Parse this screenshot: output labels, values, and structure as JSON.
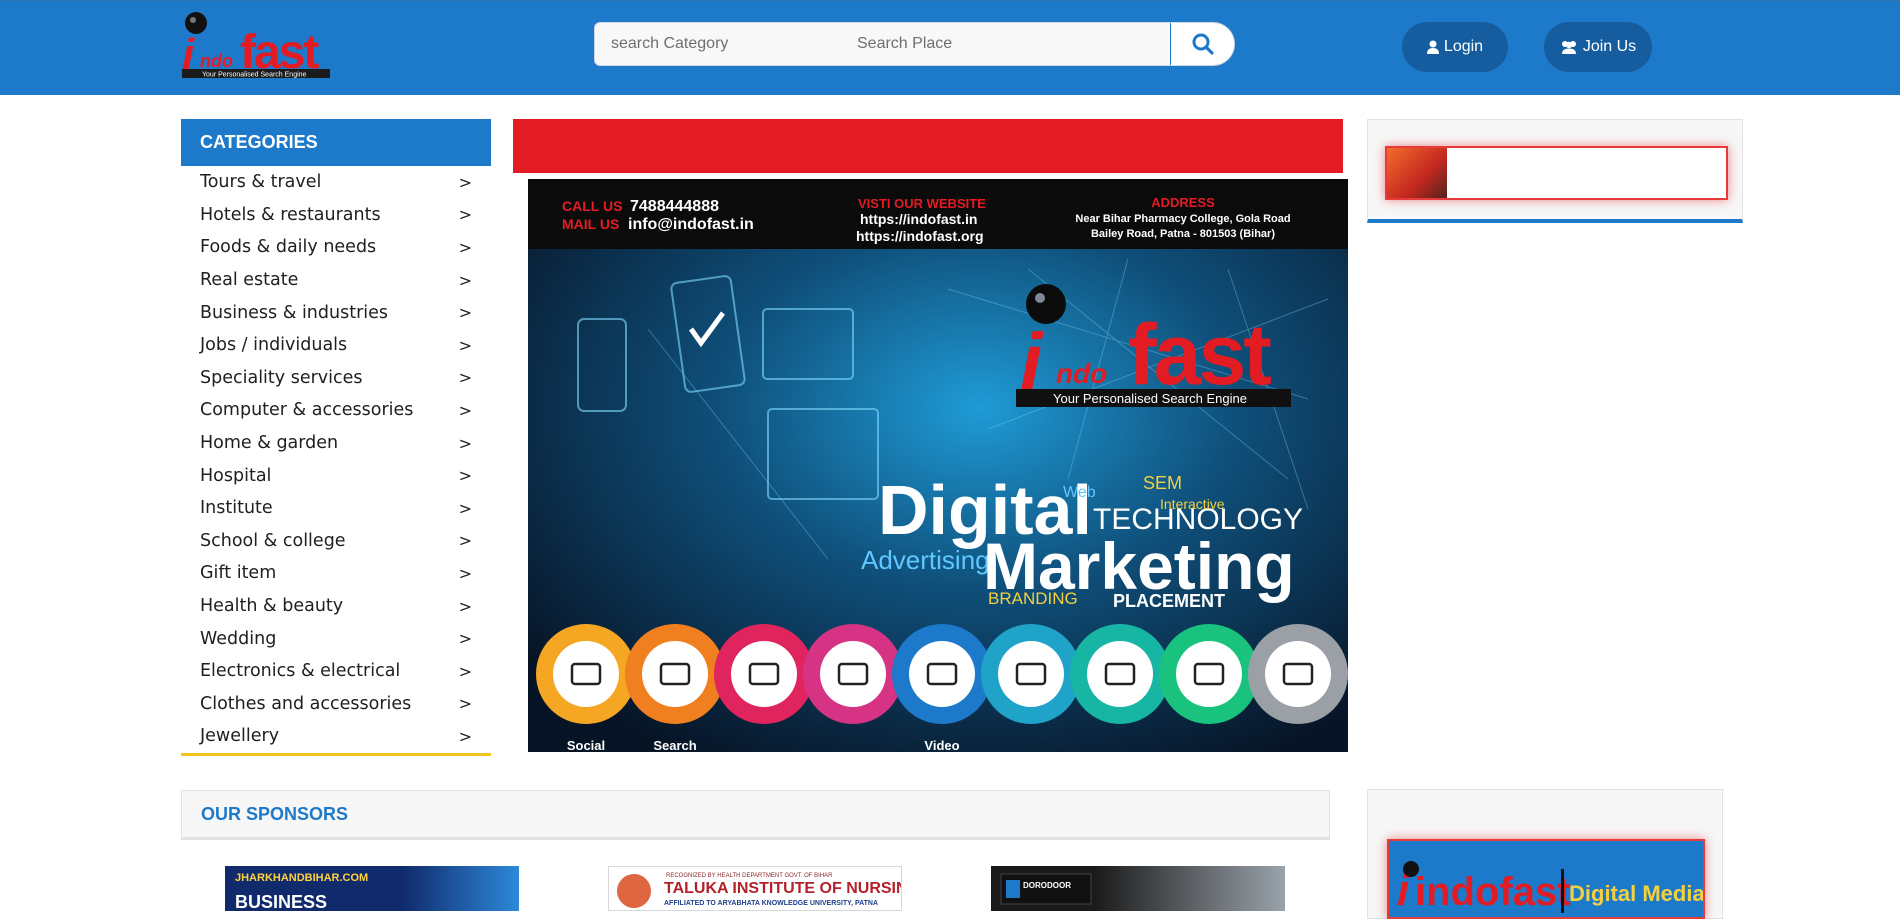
{
  "header": {
    "logo": {
      "text": "indofast",
      "tagline": "Your Personalised Search Engine"
    },
    "search": {
      "category_placeholder": "search Category",
      "place_placeholder": "Search Place"
    },
    "login_label": "Login",
    "join_label": "Join Us"
  },
  "categories": {
    "title": "CATEGORIES",
    "items": [
      {
        "label": "Tours & travel",
        "arrow": ">"
      },
      {
        "label": "Hotels & restaurants",
        "arrow": ">"
      },
      {
        "label": "Foods & daily needs",
        "arrow": ">"
      },
      {
        "label": "Real estate",
        "arrow": ">"
      },
      {
        "label": "Business & industries",
        "arrow": ">"
      },
      {
        "label": "Jobs / individuals",
        "arrow": ">"
      },
      {
        "label": "Speciality services",
        "arrow": ">"
      },
      {
        "label": "Computer & accessories",
        "arrow": ">"
      },
      {
        "label": "Home & garden",
        "arrow": ">"
      },
      {
        "label": "Hospital",
        "arrow": ">"
      },
      {
        "label": "Institute",
        "arrow": ">"
      },
      {
        "label": "School & college",
        "arrow": ">"
      },
      {
        "label": "Gift item",
        "arrow": ">"
      },
      {
        "label": "Health & beauty",
        "arrow": ">"
      },
      {
        "label": "Wedding",
        "arrow": ">"
      },
      {
        "label": "Electronics & electrical",
        "arrow": ">"
      },
      {
        "label": "Clothes and accessories",
        "arrow": ">"
      },
      {
        "label": "Jewellery",
        "arrow": ">"
      }
    ]
  },
  "banner": {
    "call_label": "CALL US",
    "phone": "7488444888",
    "mail_label": "MAIL US",
    "email": "info@indofast.in",
    "website_label": "VISTI OUR WEBSITE",
    "website1": "https://indofast.in",
    "website2": "https://indofast.org",
    "address_label": "ADDRESS",
    "address_line1": "Near Bihar Pharmacy College, Gola Road",
    "address_line2": "Bailey Road, Patna - 801503 (Bihar)",
    "logo_text": "indofast",
    "logo_tagline": "Your Personalised Search Engine",
    "headline1": "Digital",
    "headline2": "Marketing",
    "tech_word": "TECHNOLOGY",
    "adv_word": "Advertising",
    "branding_word": "BRANDING",
    "placement_word": "PLACEMENT",
    "circle_labels": [
      "Social",
      "Search",
      "",
      "",
      "Video",
      "",
      "",
      "",
      ""
    ],
    "circle_colors": [
      "#f5a623",
      "#f07f1f",
      "#e0245e",
      "#d63384",
      "#1d79c9",
      "#1fa3c9",
      "#17b6a4",
      "#19c27d",
      "#9aa0a6"
    ]
  },
  "sponsors": {
    "title": "OUR SPONSORS",
    "items": [
      {
        "line1": "JHARKHANDBIHAR.COM",
        "line2": "BUSINESS"
      },
      {
        "line1": "RECOGNIZED BY HEALTH DEPARTMENT GOVT. OF BIHAR",
        "line2": "TALUKA INSTITUTE OF NURSING",
        "line3": "AFFILIATED TO ARYABHATA KNOWLEDGE UNIVERSITY, PATNA"
      },
      {
        "line1": "DORODOOR"
      }
    ]
  },
  "right_ad2": {
    "brand": "indofast",
    "label": "Digital Media"
  },
  "colors": {
    "primary": "#1d79c9",
    "accent_red": "#e31c24",
    "accent_yellow": "#f0c419"
  }
}
